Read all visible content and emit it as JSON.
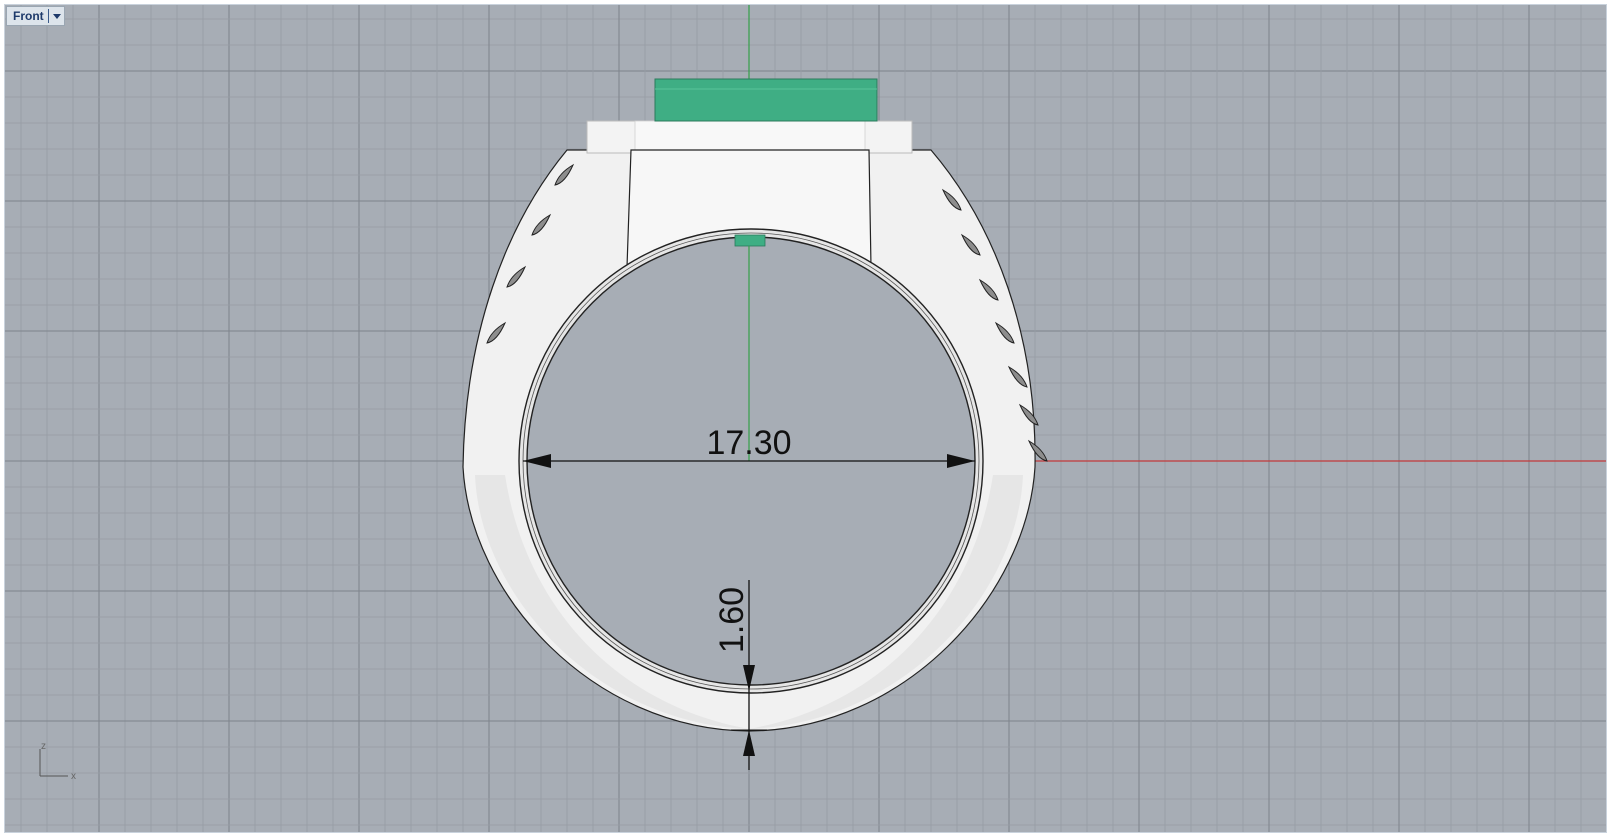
{
  "viewport": {
    "name": "Front"
  },
  "colors": {
    "background": "#a7adb5",
    "grid_minor": "#979da5",
    "grid_major": "#7e848c",
    "x_axis": "#c23a3a",
    "z_axis": "#35a04a",
    "gem": "#3fae84",
    "metal": "#f1f1f1"
  },
  "dimensions": {
    "inner_diameter": "17.30",
    "thickness": "1.60"
  },
  "axis_labels": {
    "z": "z",
    "x": "x"
  }
}
